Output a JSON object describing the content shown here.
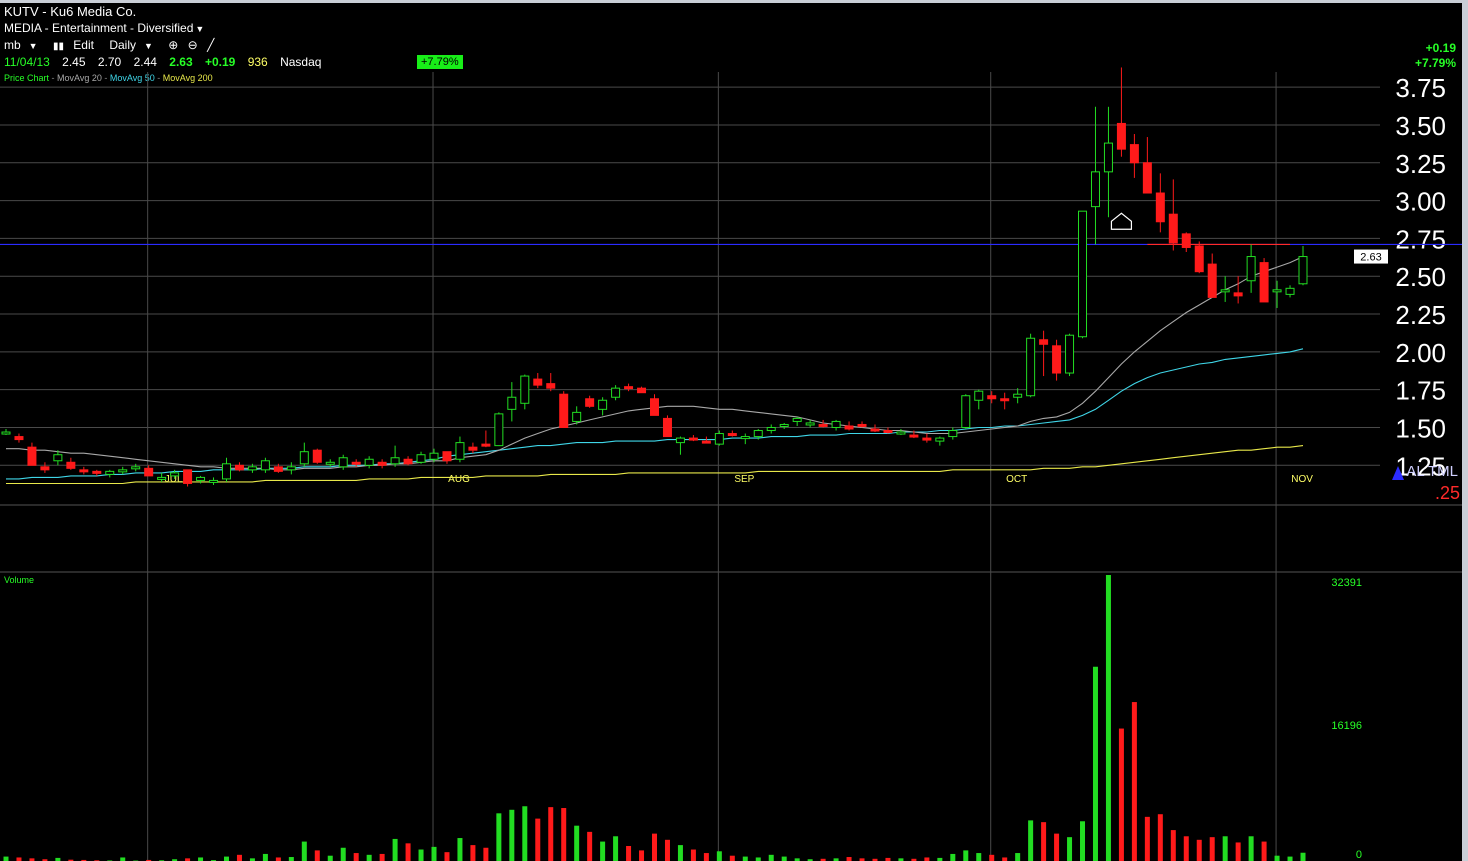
{
  "header": {
    "symbol": "KUTV - Ku6 Media Co.",
    "industry": "MEDIA - Entertainment - Diversified",
    "toolbar": {
      "list": "mb",
      "edit": "Edit",
      "period": "Daily"
    },
    "quote": {
      "date": "11/04/13",
      "open": "2.45",
      "high": "2.70",
      "low": "2.44",
      "close": "2.63",
      "change": "+0.19",
      "volume": "936",
      "exchange": "Nasdaq"
    },
    "pct_badge": "+7.79%",
    "legend": {
      "chart": "Price Chart",
      "ma20": "MovAvg 20",
      "ma50": "MovAvg 50",
      "ma200": "MovAvg 200"
    },
    "top_right_change": "+0.19",
    "top_right_pct": "+7.79%",
    "price_tag": "2.63",
    "right_bottom_text": "AL TML",
    "right_bottom_value": ".25",
    "volume_label": "Volume"
  },
  "colors": {
    "up": "#22dd22",
    "down": "#ff1a1a",
    "ma20": "#a8a8a8",
    "ma50": "#3fd6e8",
    "ma200": "#e8e84a",
    "hline": "#2b2bff",
    "grid": "#4a4a4a"
  },
  "chart_data": {
    "type": "candlestick",
    "ylim": [
      1.1,
      3.85
    ],
    "y_ticks": [
      "3.75",
      "3.50",
      "3.25",
      "3.00",
      "2.75",
      "2.50",
      "2.25",
      "2.00",
      "1.75",
      "1.50",
      "1.25"
    ],
    "months": [
      {
        "label": "JUL",
        "index": 11
      },
      {
        "label": "AUG",
        "index": 33
      },
      {
        "label": "SEP",
        "index": 55
      },
      {
        "label": "OCT",
        "index": 76
      },
      {
        "label": "NOV",
        "index": 98
      }
    ],
    "resistance_line": 2.71,
    "short_line": {
      "value": 2.71,
      "from_index": 88,
      "to_index": 99
    },
    "volume_ticks": [
      "32391",
      "16196",
      "0"
    ],
    "volume_max": 32391,
    "candles": [
      [
        1.47,
        1.49,
        1.45,
        1.47,
        500
      ],
      [
        1.44,
        1.46,
        1.4,
        1.42,
        400
      ],
      [
        1.37,
        1.4,
        1.26,
        1.25,
        300
      ],
      [
        1.24,
        1.27,
        1.2,
        1.22,
        200
      ],
      [
        1.28,
        1.35,
        1.25,
        1.32,
        350
      ],
      [
        1.27,
        1.3,
        1.22,
        1.23,
        150
      ],
      [
        1.22,
        1.24,
        1.19,
        1.21,
        120
      ],
      [
        1.21,
        1.22,
        1.18,
        1.2,
        80
      ],
      [
        1.19,
        1.22,
        1.17,
        1.21,
        60
      ],
      [
        1.21,
        1.24,
        1.19,
        1.22,
        400
      ],
      [
        1.23,
        1.26,
        1.21,
        1.24,
        50
      ],
      [
        1.23,
        1.25,
        1.19,
        1.18,
        120
      ],
      [
        1.17,
        1.2,
        1.14,
        1.17,
        80
      ],
      [
        1.18,
        1.22,
        1.16,
        1.2,
        200
      ],
      [
        1.22,
        1.2,
        1.11,
        1.13,
        300
      ],
      [
        1.15,
        1.18,
        1.13,
        1.17,
        400
      ],
      [
        1.14,
        1.17,
        1.12,
        1.15,
        100
      ],
      [
        1.16,
        1.3,
        1.14,
        1.26,
        500
      ],
      [
        1.25,
        1.27,
        1.21,
        1.22,
        700
      ],
      [
        1.22,
        1.26,
        1.2,
        1.24,
        300
      ],
      [
        1.22,
        1.3,
        1.2,
        1.28,
        800
      ],
      [
        1.24,
        1.26,
        1.2,
        1.21,
        400
      ],
      [
        1.22,
        1.27,
        1.19,
        1.24,
        450
      ],
      [
        1.26,
        1.4,
        1.24,
        1.34,
        2200
      ],
      [
        1.35,
        1.36,
        1.26,
        1.27,
        1200
      ],
      [
        1.26,
        1.29,
        1.24,
        1.27,
        600
      ],
      [
        1.24,
        1.32,
        1.22,
        1.3,
        1500
      ],
      [
        1.27,
        1.29,
        1.24,
        1.26,
        900
      ],
      [
        1.25,
        1.31,
        1.23,
        1.29,
        700
      ],
      [
        1.27,
        1.29,
        1.23,
        1.25,
        800
      ],
      [
        1.26,
        1.38,
        1.24,
        1.3,
        2500
      ],
      [
        1.29,
        1.31,
        1.25,
        1.26,
        2000
      ],
      [
        1.27,
        1.34,
        1.26,
        1.32,
        1300
      ],
      [
        1.29,
        1.36,
        1.27,
        1.33,
        1600
      ],
      [
        1.34,
        1.3,
        1.26,
        1.28,
        1000
      ],
      [
        1.29,
        1.44,
        1.27,
        1.4,
        2600
      ],
      [
        1.37,
        1.4,
        1.33,
        1.35,
        1800
      ],
      [
        1.39,
        1.48,
        1.37,
        1.38,
        1500
      ],
      [
        1.38,
        1.6,
        1.38,
        1.59,
        5400
      ],
      [
        1.62,
        1.8,
        1.54,
        1.7,
        5800
      ],
      [
        1.66,
        1.85,
        1.62,
        1.84,
        6200
      ],
      [
        1.82,
        1.86,
        1.76,
        1.78,
        4800
      ],
      [
        1.79,
        1.86,
        1.74,
        1.76,
        6100
      ],
      [
        1.72,
        1.74,
        1.53,
        1.5,
        6000
      ],
      [
        1.54,
        1.64,
        1.52,
        1.6,
        4000
      ],
      [
        1.69,
        1.71,
        1.63,
        1.64,
        3300
      ],
      [
        1.62,
        1.7,
        1.58,
        1.68,
        2200
      ],
      [
        1.7,
        1.78,
        1.68,
        1.76,
        2800
      ],
      [
        1.77,
        1.79,
        1.74,
        1.76,
        1700
      ],
      [
        1.76,
        1.77,
        1.73,
        1.73,
        1200
      ],
      [
        1.69,
        1.72,
        1.6,
        1.58,
        3100
      ],
      [
        1.56,
        1.58,
        1.45,
        1.44,
        2400
      ],
      [
        1.4,
        1.44,
        1.32,
        1.43,
        1800
      ],
      [
        1.43,
        1.45,
        1.41,
        1.42,
        1300
      ],
      [
        1.41,
        1.44,
        1.4,
        1.4,
        900
      ],
      [
        1.39,
        1.48,
        1.38,
        1.46,
        1100
      ],
      [
        1.46,
        1.48,
        1.44,
        1.45,
        600
      ],
      [
        1.43,
        1.46,
        1.39,
        1.44,
        500
      ],
      [
        1.44,
        1.49,
        1.42,
        1.48,
        400
      ],
      [
        1.48,
        1.52,
        1.46,
        1.5,
        700
      ],
      [
        1.51,
        1.53,
        1.49,
        1.52,
        500
      ],
      [
        1.54,
        1.57,
        1.51,
        1.56,
        300
      ],
      [
        1.52,
        1.55,
        1.5,
        1.53,
        200
      ],
      [
        1.52,
        1.55,
        1.5,
        1.51,
        250
      ],
      [
        1.5,
        1.55,
        1.48,
        1.54,
        300
      ],
      [
        1.51,
        1.54,
        1.48,
        1.49,
        450
      ],
      [
        1.52,
        1.54,
        1.5,
        1.51,
        300
      ],
      [
        1.49,
        1.52,
        1.47,
        1.48,
        250
      ],
      [
        1.48,
        1.5,
        1.46,
        1.47,
        350
      ],
      [
        1.46,
        1.49,
        1.45,
        1.47,
        300
      ],
      [
        1.45,
        1.48,
        1.43,
        1.44,
        250
      ],
      [
        1.43,
        1.46,
        1.4,
        1.42,
        400
      ],
      [
        1.41,
        1.44,
        1.38,
        1.43,
        350
      ],
      [
        1.44,
        1.5,
        1.42,
        1.48,
        800
      ],
      [
        1.5,
        1.72,
        1.49,
        1.71,
        1200
      ],
      [
        1.68,
        1.75,
        1.62,
        1.74,
        900
      ],
      [
        1.71,
        1.74,
        1.66,
        1.69,
        700
      ],
      [
        1.69,
        1.73,
        1.62,
        1.68,
        400
      ],
      [
        1.7,
        1.76,
        1.66,
        1.72,
        900
      ],
      [
        1.71,
        2.12,
        1.7,
        2.09,
        4600
      ],
      [
        2.08,
        2.14,
        1.84,
        2.05,
        4400
      ],
      [
        2.04,
        2.08,
        1.81,
        1.86,
        3100
      ],
      [
        1.86,
        2.12,
        1.84,
        2.11,
        2700
      ],
      [
        2.1,
        2.92,
        2.09,
        2.93,
        4500
      ],
      [
        2.96,
        3.62,
        2.71,
        3.19,
        22000
      ],
      [
        3.19,
        3.62,
        2.89,
        3.38,
        32391
      ],
      [
        3.51,
        3.88,
        3.29,
        3.34,
        15000
      ],
      [
        3.37,
        3.44,
        3.15,
        3.25,
        18000
      ],
      [
        3.25,
        3.42,
        3.06,
        3.05,
        5000
      ],
      [
        3.05,
        3.18,
        2.79,
        2.86,
        5300
      ],
      [
        2.91,
        3.14,
        2.67,
        2.72,
        3500
      ],
      [
        2.78,
        2.79,
        2.66,
        2.69,
        2800
      ],
      [
        2.7,
        2.73,
        2.52,
        2.53,
        2400
      ],
      [
        2.58,
        2.65,
        2.38,
        2.36,
        2700
      ],
      [
        2.4,
        2.5,
        2.33,
        2.41,
        2800
      ],
      [
        2.39,
        2.5,
        2.32,
        2.37,
        2100
      ],
      [
        2.47,
        2.71,
        2.39,
        2.63,
        2800
      ],
      [
        2.59,
        2.62,
        2.37,
        2.33,
        2200
      ],
      [
        2.4,
        2.47,
        2.29,
        2.41,
        600
      ],
      [
        2.38,
        2.44,
        2.36,
        2.42,
        500
      ],
      [
        2.45,
        2.7,
        2.44,
        2.63,
        936
      ]
    ],
    "ma20": [
      1.36,
      1.36,
      1.35,
      1.35,
      1.34,
      1.33,
      1.33,
      1.32,
      1.31,
      1.3,
      1.29,
      1.28,
      1.27,
      1.26,
      1.25,
      1.24,
      1.24,
      1.23,
      1.23,
      1.23,
      1.23,
      1.22,
      1.22,
      1.23,
      1.23,
      1.23,
      1.24,
      1.24,
      1.25,
      1.25,
      1.26,
      1.26,
      1.27,
      1.28,
      1.28,
      1.3,
      1.31,
      1.32,
      1.35,
      1.39,
      1.43,
      1.46,
      1.49,
      1.51,
      1.53,
      1.55,
      1.57,
      1.59,
      1.61,
      1.62,
      1.63,
      1.64,
      1.64,
      1.64,
      1.63,
      1.62,
      1.62,
      1.61,
      1.6,
      1.59,
      1.58,
      1.57,
      1.55,
      1.53,
      1.52,
      1.51,
      1.5,
      1.49,
      1.48,
      1.48,
      1.47,
      1.46,
      1.46,
      1.46,
      1.47,
      1.48,
      1.49,
      1.5,
      1.51,
      1.54,
      1.56,
      1.57,
      1.6,
      1.66,
      1.74,
      1.83,
      1.92,
      2.0,
      2.07,
      2.14,
      2.2,
      2.26,
      2.31,
      2.36,
      2.41,
      2.45,
      2.5,
      2.53,
      2.56,
      2.59,
      2.63
    ],
    "ma50": [
      1.16,
      1.16,
      1.17,
      1.17,
      1.17,
      1.18,
      1.18,
      1.18,
      1.19,
      1.19,
      1.2,
      1.2,
      1.2,
      1.21,
      1.21,
      1.21,
      1.22,
      1.22,
      1.22,
      1.22,
      1.23,
      1.23,
      1.23,
      1.24,
      1.24,
      1.24,
      1.25,
      1.25,
      1.25,
      1.26,
      1.26,
      1.27,
      1.28,
      1.29,
      1.31,
      1.32,
      1.33,
      1.34,
      1.35,
      1.36,
      1.37,
      1.38,
      1.38,
      1.39,
      1.4,
      1.4,
      1.4,
      1.41,
      1.41,
      1.41,
      1.41,
      1.42,
      1.42,
      1.42,
      1.42,
      1.42,
      1.43,
      1.43,
      1.43,
      1.44,
      1.44,
      1.44,
      1.45,
      1.45,
      1.45,
      1.46,
      1.46,
      1.46,
      1.46,
      1.47,
      1.47,
      1.47,
      1.48,
      1.48,
      1.49,
      1.5,
      1.5,
      1.51,
      1.51,
      1.52,
      1.53,
      1.54,
      1.55,
      1.58,
      1.62,
      1.68,
      1.74,
      1.79,
      1.83,
      1.86,
      1.88,
      1.9,
      1.92,
      1.93,
      1.95,
      1.96,
      1.97,
      1.98,
      1.99,
      2.0,
      2.02
    ],
    "ma200": [
      1.13,
      1.13,
      1.13,
      1.13,
      1.13,
      1.13,
      1.13,
      1.13,
      1.13,
      1.13,
      1.14,
      1.14,
      1.14,
      1.14,
      1.14,
      1.14,
      1.14,
      1.14,
      1.14,
      1.14,
      1.15,
      1.15,
      1.15,
      1.15,
      1.15,
      1.15,
      1.15,
      1.15,
      1.16,
      1.16,
      1.16,
      1.16,
      1.17,
      1.17,
      1.17,
      1.17,
      1.17,
      1.18,
      1.18,
      1.18,
      1.18,
      1.18,
      1.19,
      1.19,
      1.19,
      1.19,
      1.19,
      1.19,
      1.2,
      1.2,
      1.2,
      1.2,
      1.2,
      1.2,
      1.2,
      1.2,
      1.2,
      1.2,
      1.21,
      1.21,
      1.21,
      1.21,
      1.21,
      1.21,
      1.21,
      1.21,
      1.21,
      1.21,
      1.21,
      1.21,
      1.21,
      1.21,
      1.21,
      1.22,
      1.22,
      1.22,
      1.22,
      1.22,
      1.22,
      1.22,
      1.23,
      1.23,
      1.23,
      1.24,
      1.24,
      1.25,
      1.26,
      1.27,
      1.28,
      1.29,
      1.3,
      1.31,
      1.32,
      1.33,
      1.34,
      1.35,
      1.35,
      1.36,
      1.37,
      1.37,
      1.38
    ]
  }
}
